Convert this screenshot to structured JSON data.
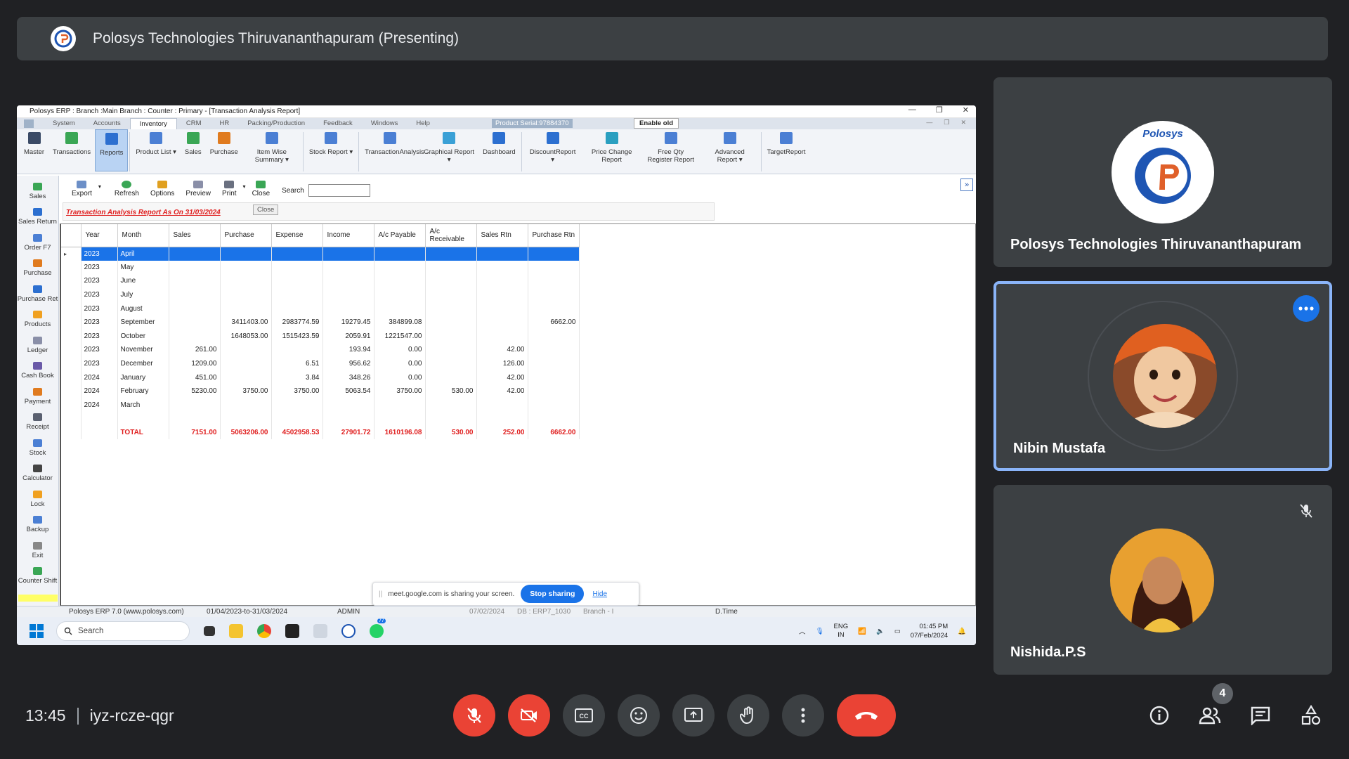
{
  "presenter_bar": {
    "title": "Polosys Technologies Thiruvananthapuram (Presenting)"
  },
  "erp": {
    "window_title": "Polosys ERP  :  Branch :Main Branch : Counter : Primary - [Transaction Analysis Report]",
    "menu": [
      "System",
      "Accounts",
      "Inventory",
      "CRM",
      "HR",
      "Packing/Production",
      "Feedback",
      "Windows",
      "Help"
    ],
    "active_menu": "Inventory",
    "product_serial": "Product Serial:97884370",
    "enable_old": "Enable old",
    "ribbon": [
      {
        "label": "Master",
        "icon": "master-icon",
        "color": "#3a4a66"
      },
      {
        "label": "Transactions",
        "icon": "transactions-icon",
        "color": "#3aa655"
      },
      {
        "label": "Reports",
        "icon": "reports-icon",
        "color": "#2c6fd0"
      },
      {
        "label": "Product List ▾",
        "icon": "product-list-icon",
        "color": "#4b7fd4"
      },
      {
        "label": "Sales",
        "icon": "sales-icon",
        "color": "#3aa655"
      },
      {
        "label": "Purchase",
        "icon": "purchase-icon",
        "color": "#e07b1f"
      },
      {
        "label": "Item Wise Summary ▾",
        "icon": "item-wise-summary-icon",
        "color": "#4b7fd4"
      },
      {
        "label": "Stock Report ▾",
        "icon": "stock-report-icon",
        "color": "#4b7fd4"
      },
      {
        "label": "TransactionAnalysis",
        "icon": "transaction-analysis-icon",
        "color": "#4b7fd4"
      },
      {
        "label": "Graphical Report ▾",
        "icon": "graphical-report-icon",
        "color": "#3aa0d6"
      },
      {
        "label": "Dashboard",
        "icon": "dashboard-icon",
        "color": "#2c6fd0"
      },
      {
        "label": "DiscountReport ▾",
        "icon": "discount-report-icon",
        "color": "#2c6fd0"
      },
      {
        "label": "Price Change Report",
        "icon": "price-change-report-icon",
        "color": "#2a9fc0"
      },
      {
        "label": "Free Qty Register Report",
        "icon": "free-qty-register-report-icon",
        "color": "#4b7fd4"
      },
      {
        "label": "Advanced Report ▾",
        "icon": "advanced-report-icon",
        "color": "#4b7fd4"
      },
      {
        "label": "TargetReport",
        "icon": "target-report-icon",
        "color": "#4b7fd4"
      }
    ],
    "sidebar": [
      {
        "label": "Sales",
        "icon": "sales-icon",
        "color": "#3aa655"
      },
      {
        "label": "Sales Return",
        "icon": "sales-return-icon",
        "color": "#2c6fd0"
      },
      {
        "label": "Order F7",
        "icon": "order-icon",
        "color": "#4b7fd4"
      },
      {
        "label": "Purchase",
        "icon": "purchase-icon",
        "color": "#e07b1f"
      },
      {
        "label": "Purchase Ret",
        "icon": "purchase-return-icon",
        "color": "#2c6fd0"
      },
      {
        "label": "Products",
        "icon": "products-icon",
        "color": "#f0a020"
      },
      {
        "label": "Ledger",
        "icon": "ledger-icon",
        "color": "#8a8fa8"
      },
      {
        "label": "Cash Book",
        "icon": "cash-book-icon",
        "color": "#6a5aa8"
      },
      {
        "label": "Payment",
        "icon": "payment-icon",
        "color": "#e07b1f"
      },
      {
        "label": "Receipt",
        "icon": "receipt-icon",
        "color": "#5a6070"
      },
      {
        "label": "Stock",
        "icon": "stock-icon",
        "color": "#4b7fd4"
      },
      {
        "label": "Calculator",
        "icon": "calculator-icon",
        "color": "#444"
      },
      {
        "label": "Lock",
        "icon": "lock-icon",
        "color": "#f0a020"
      },
      {
        "label": "Backup",
        "icon": "backup-icon",
        "color": "#4b7fd4"
      },
      {
        "label": "Exit",
        "icon": "exit-icon",
        "color": "#888"
      },
      {
        "label": "Counter Shift",
        "icon": "counter-shift-icon",
        "color": "#3aa655"
      }
    ],
    "toolbar": {
      "export": "Export",
      "refresh": "Refresh",
      "options": "Options",
      "preview": "Preview",
      "print": "Print",
      "close": "Close",
      "search_label": "Search"
    },
    "report": {
      "title": "Transaction Analysis Report As On 31/03/2024",
      "close_button": "Close",
      "columns": [
        "Year",
        "Month",
        "Sales",
        "Purchase",
        "Expense",
        "Income",
        "A/c Payable",
        "A/c Receivable",
        "Sales Rtn",
        "Purchase Rtn"
      ],
      "rows": [
        [
          "2023",
          "April",
          "",
          "",
          "",
          "",
          "",
          "",
          "",
          ""
        ],
        [
          "2023",
          "May",
          "",
          "",
          "",
          "",
          "",
          "",
          "",
          ""
        ],
        [
          "2023",
          "June",
          "",
          "",
          "",
          "",
          "",
          "",
          "",
          ""
        ],
        [
          "2023",
          "July",
          "",
          "",
          "",
          "",
          "",
          "",
          "",
          ""
        ],
        [
          "2023",
          "August",
          "",
          "",
          "",
          "",
          "",
          "",
          "",
          ""
        ],
        [
          "2023",
          "September",
          "",
          "3411403.00",
          "2983774.59",
          "19279.45",
          "384899.08",
          "",
          "",
          "6662.00"
        ],
        [
          "2023",
          "October",
          "",
          "1648053.00",
          "1515423.59",
          "2059.91",
          "1221547.00",
          "",
          "",
          ""
        ],
        [
          "2023",
          "November",
          "261.00",
          "",
          "",
          "193.94",
          "0.00",
          "",
          "42.00",
          ""
        ],
        [
          "2023",
          "December",
          "1209.00",
          "",
          "6.51",
          "956.62",
          "0.00",
          "",
          "126.00",
          ""
        ],
        [
          "2024",
          "January",
          "451.00",
          "",
          "3.84",
          "348.26",
          "0.00",
          "",
          "42.00",
          ""
        ],
        [
          "2024",
          "February",
          "5230.00",
          "3750.00",
          "3750.00",
          "5063.54",
          "3750.00",
          "530.00",
          "42.00",
          ""
        ],
        [
          "2024",
          "March",
          "",
          "",
          "",
          "",
          "",
          "",
          "",
          ""
        ]
      ],
      "total": [
        "",
        "TOTAL",
        "7151.00",
        "5063206.00",
        "4502958.53",
        "27901.72",
        "1610196.08",
        "530.00",
        "252.00",
        "6662.00"
      ]
    },
    "statusbar": {
      "app": "Polosys ERP 7.0 (www.polosys.com)",
      "period": "01/04/2023-to-31/03/2024",
      "user": "ADMIN",
      "date": "07/02/2024",
      "db": "DB : ERP7_1030",
      "branch": "Branch - I",
      "dtime": "D.Time"
    }
  },
  "share_banner": {
    "text": "meet.google.com is sharing your screen.",
    "stop": "Stop sharing",
    "hide": "Hide"
  },
  "taskbar": {
    "search": "Search",
    "lang1": "ENG",
    "lang2": "IN",
    "time": "01:45 PM",
    "date": "07/Feb/2024",
    "notif_count": "77"
  },
  "participants": [
    {
      "name": "Polosys Technologies Thiruvananthapuram",
      "logo_text": "Polosys"
    },
    {
      "name": "Nibin Mustafa"
    },
    {
      "name": "Nishida.P.S"
    }
  ],
  "call": {
    "time": "13:45",
    "code": "iyz-rcze-qgr",
    "people_count": "4"
  },
  "colors": {
    "meet_bg": "#202124",
    "tile_bg": "#3c4043",
    "accent_blue": "#1a73e8",
    "red": "#ea4335",
    "report_red": "#e02020"
  }
}
